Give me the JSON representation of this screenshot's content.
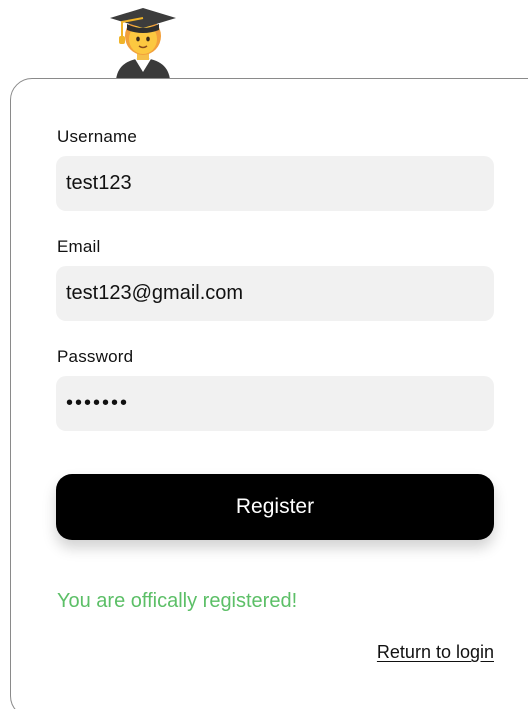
{
  "form": {
    "username": {
      "label": "Username",
      "value": "test123"
    },
    "email": {
      "label": "Email",
      "value": "test123@gmail.com"
    },
    "password": {
      "label": "Password",
      "value": "•••••••"
    },
    "register_label": "Register",
    "success_message": "You are offically registered!",
    "return_label": "Return to login"
  },
  "icons": {
    "avatar": "student-graduation-cap-icon"
  },
  "colors": {
    "success": "#5cbf67",
    "button": "#000000",
    "field_bg": "#f1f1f1"
  }
}
